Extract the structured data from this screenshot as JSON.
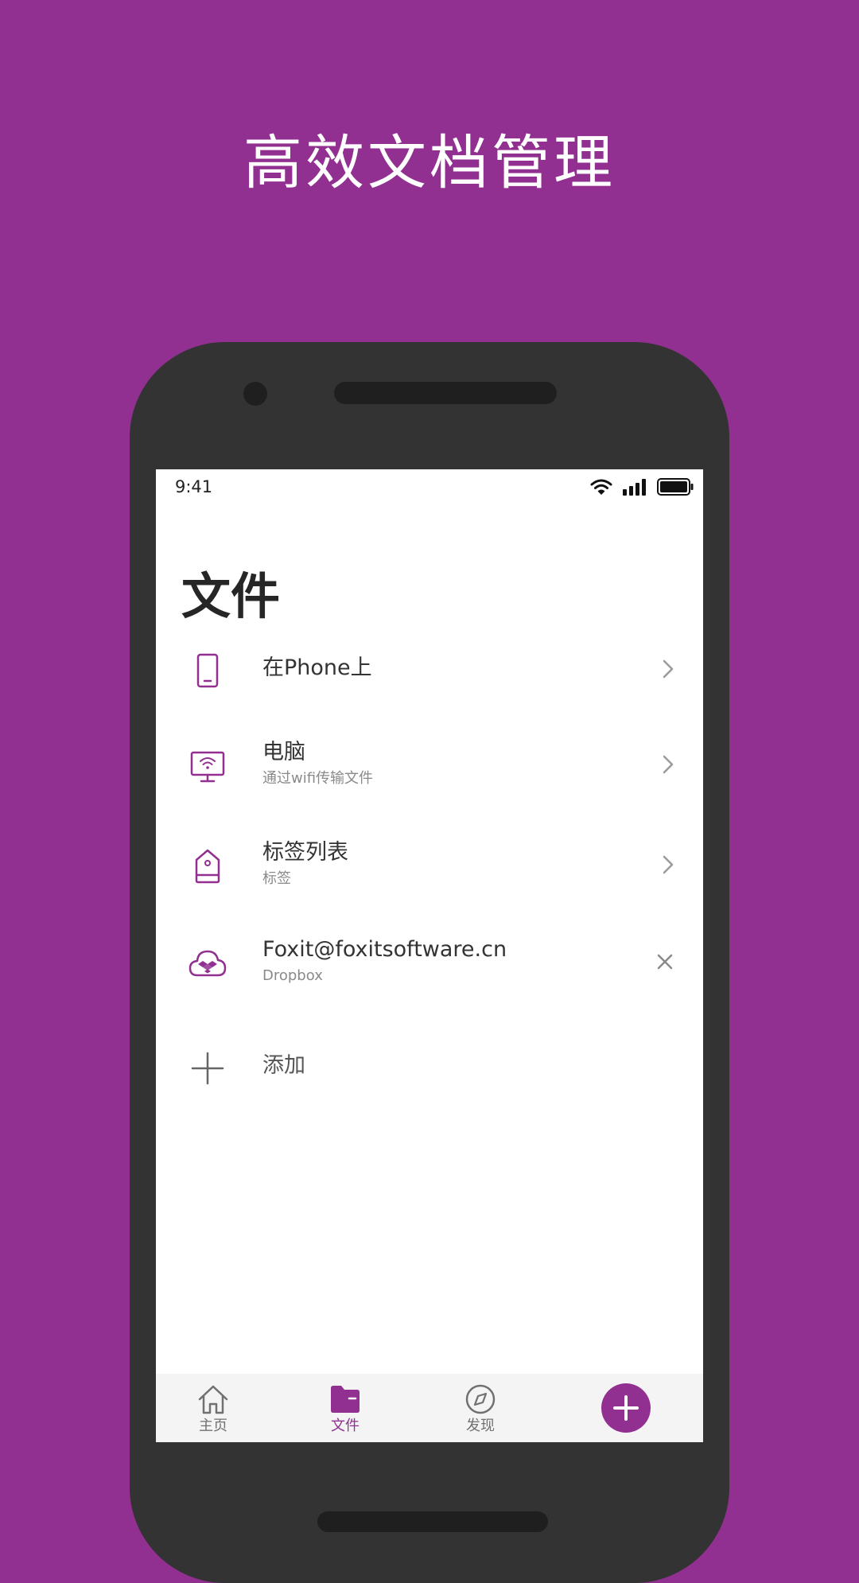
{
  "headline": "高效文档管理",
  "colors": {
    "background": "#913090",
    "accent": "#913090",
    "phone_body": "#333333",
    "screen": "#ffffff"
  },
  "status_bar": {
    "time": "9:41",
    "icons": [
      "wifi-icon",
      "signal-icon",
      "battery-icon"
    ]
  },
  "page": {
    "title": "文件"
  },
  "locations": [
    {
      "icon": "phone-icon",
      "title": "在Phone上",
      "subtitle": "",
      "action": "chevron-right-icon"
    },
    {
      "icon": "monitor-wifi-icon",
      "title": "电脑",
      "subtitle": "通过wifi传输文件",
      "action": "chevron-right-icon"
    },
    {
      "icon": "tag-icon",
      "title": "标签列表",
      "subtitle": "标签",
      "action": "chevron-right-icon"
    },
    {
      "icon": "dropbox-cloud-icon",
      "title": "Foxit@foxitsoftware.cn",
      "subtitle": "Dropbox",
      "action": "close-icon"
    },
    {
      "icon": "plus-icon",
      "title": "添加",
      "subtitle": "",
      "action": ""
    }
  ],
  "tabbar": {
    "tabs": [
      {
        "icon": "home-icon",
        "label": "主页",
        "active": false
      },
      {
        "icon": "folder-icon",
        "label": "文件",
        "active": true
      },
      {
        "icon": "compass-icon",
        "label": "发现",
        "active": false
      }
    ],
    "fab_icon": "plus-icon"
  }
}
